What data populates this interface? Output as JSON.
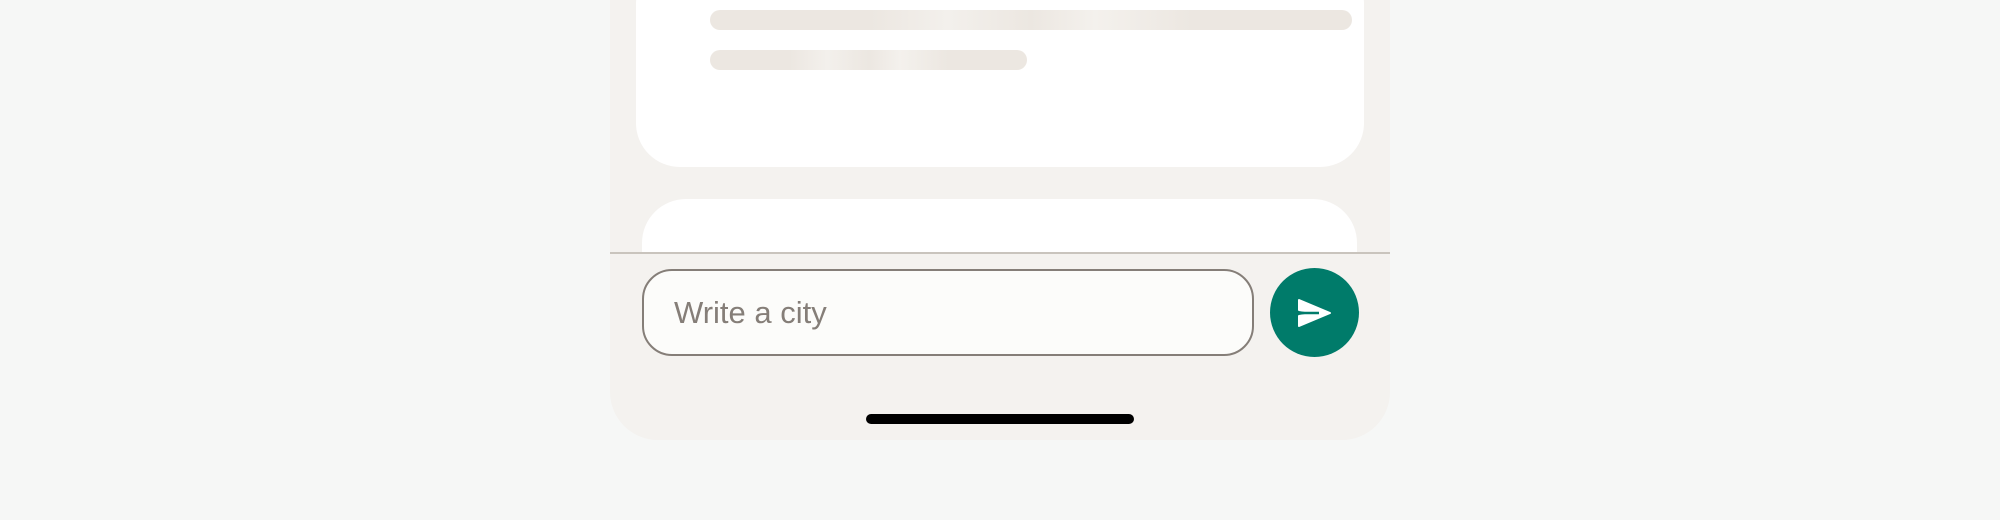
{
  "composer": {
    "input_placeholder": "Write a city",
    "input_value": "",
    "send_icon": "send-icon"
  },
  "feed": {
    "loading_card": {
      "skeleton_lines": 2
    }
  },
  "colors": {
    "page_background": "#f6f7f6",
    "app_background": "#f4f2ef",
    "card_background": "#ffffff",
    "skeleton": "#ece7e1",
    "input_border": "#857e78",
    "accent": "#007b6a",
    "home_indicator": "#000000"
  }
}
